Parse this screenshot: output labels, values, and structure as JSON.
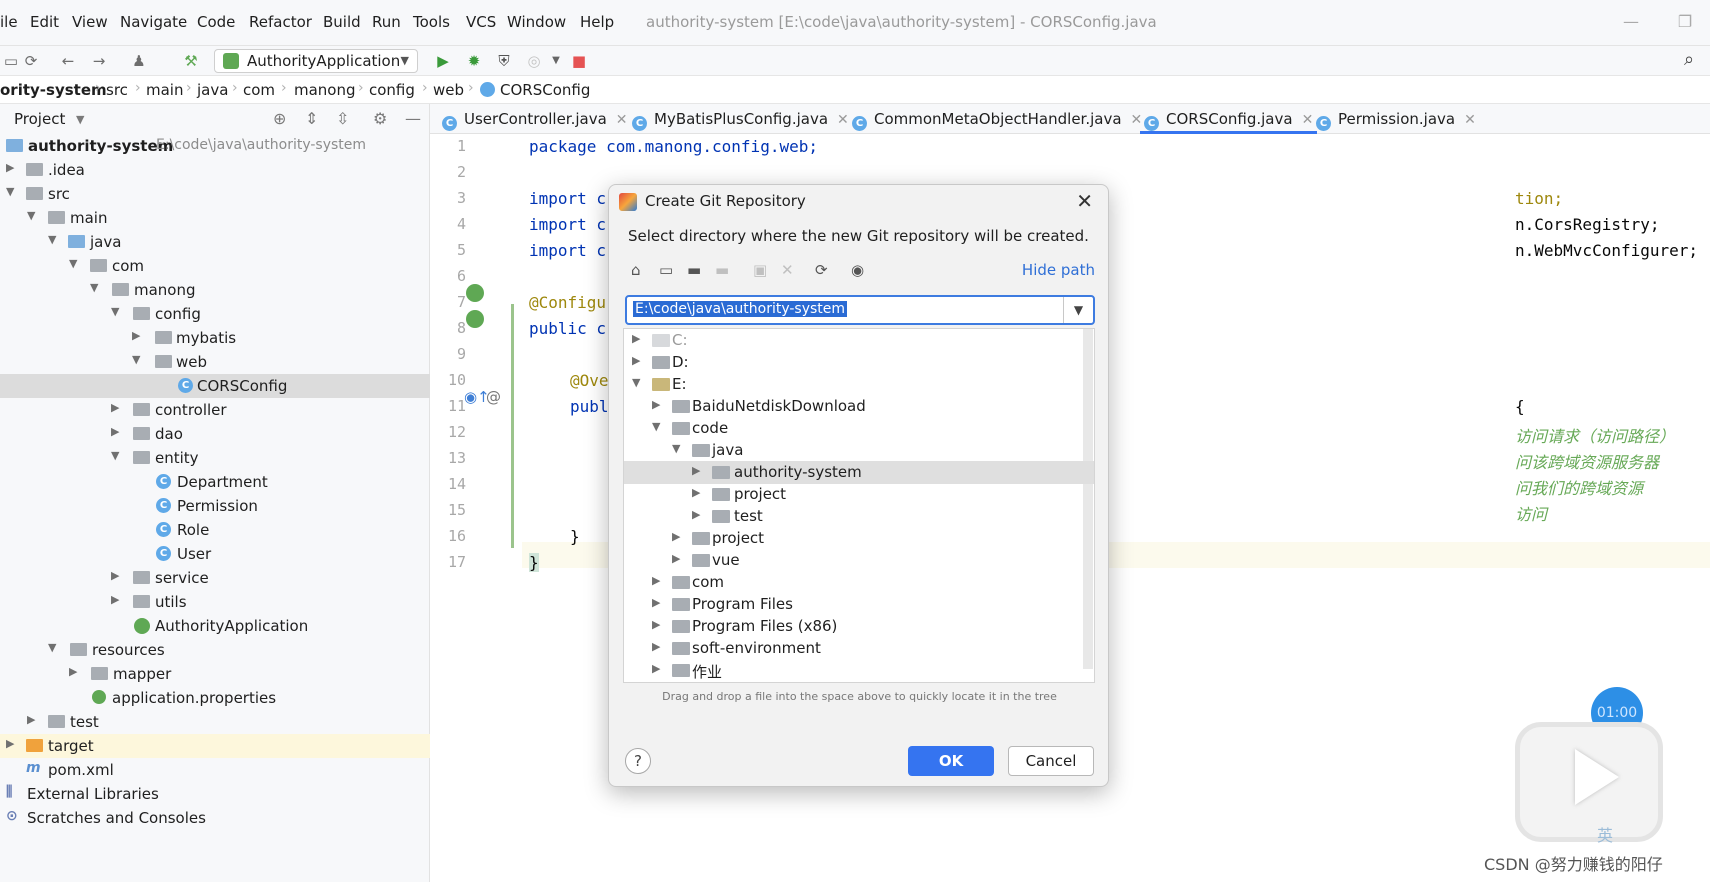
{
  "menu": {
    "items": [
      "ile",
      "Edit",
      "View",
      "Navigate",
      "Code",
      "Refactor",
      "Build",
      "Run",
      "Tools",
      "VCS",
      "Window",
      "Help"
    ]
  },
  "window_title": "authority-system [E:\\code\\java\\authority-system] - CORSConfig.java",
  "toolbar": {
    "run_config": "AuthorityApplication"
  },
  "breadcrumb": [
    "ority-system",
    "src",
    "main",
    "java",
    "com",
    "manong",
    "config",
    "web",
    "CORSConfig"
  ],
  "project_panel": {
    "title": "Project",
    "tree": [
      {
        "label": "authority-system",
        "sub": "E:\\code\\java\\authority-system"
      },
      {
        "label": ".idea"
      },
      {
        "label": "src"
      },
      {
        "label": "main"
      },
      {
        "label": "java"
      },
      {
        "label": "com"
      },
      {
        "label": "manong"
      },
      {
        "label": "config"
      },
      {
        "label": "mybatis"
      },
      {
        "label": "web"
      },
      {
        "label": "CORSConfig"
      },
      {
        "label": "controller"
      },
      {
        "label": "dao"
      },
      {
        "label": "entity"
      },
      {
        "label": "Department"
      },
      {
        "label": "Permission"
      },
      {
        "label": "Role"
      },
      {
        "label": "User"
      },
      {
        "label": "service"
      },
      {
        "label": "utils"
      },
      {
        "label": "AuthorityApplication"
      },
      {
        "label": "resources"
      },
      {
        "label": "mapper"
      },
      {
        "label": "application.properties"
      },
      {
        "label": "test"
      },
      {
        "label": "target"
      },
      {
        "label": "pom.xml"
      },
      {
        "label": "External Libraries"
      },
      {
        "label": "Scratches and Consoles"
      }
    ]
  },
  "tabs": [
    {
      "label": "UserController.java"
    },
    {
      "label": "MyBatisPlusConfig.java"
    },
    {
      "label": "CommonMetaObjectHandler.java"
    },
    {
      "label": "CORSConfig.java"
    },
    {
      "label": "Permission.java"
    }
  ],
  "editor": {
    "line_numbers": [
      "1",
      "2",
      "3",
      "4",
      "5",
      "6",
      "7",
      "8",
      "9",
      "10",
      "11",
      "12",
      "13",
      "14",
      "15",
      "16",
      "17"
    ],
    "lines": {
      "l1": "package com.manong.config.web;",
      "l3a": "import c",
      "l3b": "tion;",
      "l4a": "import c",
      "l4b": "n.CorsRegistry;",
      "l5a": "import c",
      "l5b": "n.WebMvcConfigurer;",
      "l7": "@Configu",
      "l8a": "public c",
      "l10": "@Ove",
      "l11": "publ",
      "l11b": "{",
      "l12": "访问请求（访问路径）",
      "l13": "问该跨域资源服务器",
      "l14": "问我们的跨域资源",
      "l15": "访问",
      "l16": "}",
      "l17": "}"
    }
  },
  "dialog": {
    "title": "Create Git Repository",
    "description": "Select directory where the new Git repository will be created.",
    "hide_path": "Hide path",
    "path_value": "E:\\code\\java\\authority-system",
    "tree": [
      {
        "label": "C:"
      },
      {
        "label": "D:"
      },
      {
        "label": "E:"
      },
      {
        "label": "BaiduNetdiskDownload"
      },
      {
        "label": "code"
      },
      {
        "label": "java"
      },
      {
        "label": "authority-system"
      },
      {
        "label": "project"
      },
      {
        "label": "test"
      },
      {
        "label": "project"
      },
      {
        "label": "vue"
      },
      {
        "label": "com"
      },
      {
        "label": "Program Files"
      },
      {
        "label": "Program Files (x86)"
      },
      {
        "label": "soft-environment"
      },
      {
        "label": "作业"
      }
    ],
    "hint": "Drag and drop a file into the space above to quickly locate it in the tree",
    "help": "?",
    "ok": "OK",
    "cancel": "Cancel"
  },
  "overlay": {
    "timer": "01:00",
    "ime": "英",
    "watermark": "CSDN @努力赚钱的阳仔"
  }
}
